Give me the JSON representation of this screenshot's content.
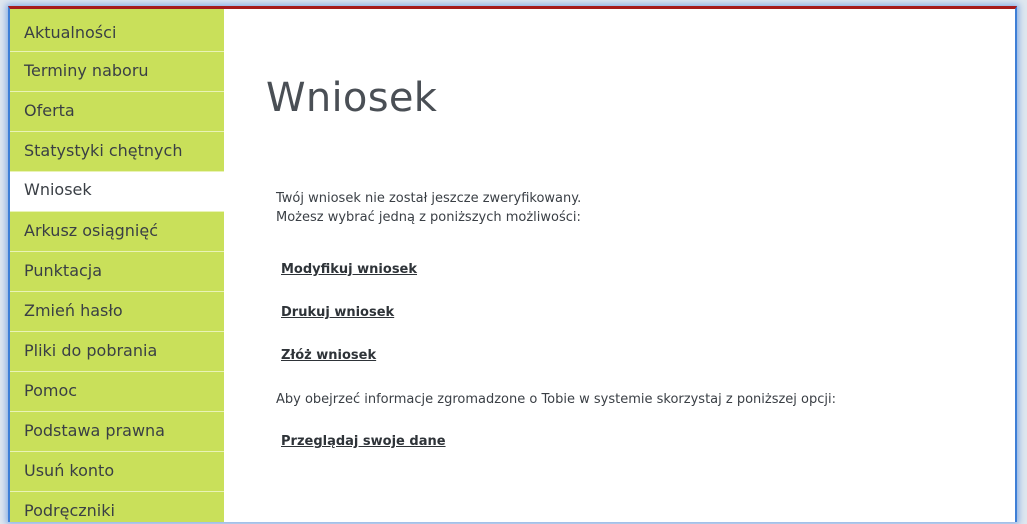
{
  "sidebar": {
    "items": [
      {
        "label": "Aktualności"
      },
      {
        "label": "Terminy naboru"
      },
      {
        "label": "Oferta"
      },
      {
        "label": "Statystyki chętnych"
      },
      {
        "label": "Wniosek"
      },
      {
        "label": "Arkusz osiągnięć"
      },
      {
        "label": "Punktacja"
      },
      {
        "label": "Zmień hasło"
      },
      {
        "label": "Pliki do pobrania"
      },
      {
        "label": "Pomoc"
      },
      {
        "label": "Podstawa prawna"
      },
      {
        "label": "Usuń konto"
      },
      {
        "label": "Podręczniki"
      }
    ],
    "active_label": "Wniosek"
  },
  "main": {
    "title": "Wniosek",
    "status_line1": "Twój wniosek nie został jeszcze zweryfikowany.",
    "status_line2": "Możesz wybrać jedną z poniższych możliwości:",
    "actions": {
      "modify": "Modyfikuj wniosek",
      "print": "Drukuj wniosek",
      "submit": "Złóż wniosek"
    },
    "info_text": "Aby obejrzeć informacje zgromadzone o Tobie w systemie skorzystaj z poniższej opcji:",
    "view_data": "Przeglądaj swoje dane"
  },
  "colors": {
    "sidebar_bg": "#c9e05a",
    "active_item_bg": "#ffffff",
    "frame_top_border": "#a61b1b",
    "frame_glow": "#3e7fd6"
  }
}
